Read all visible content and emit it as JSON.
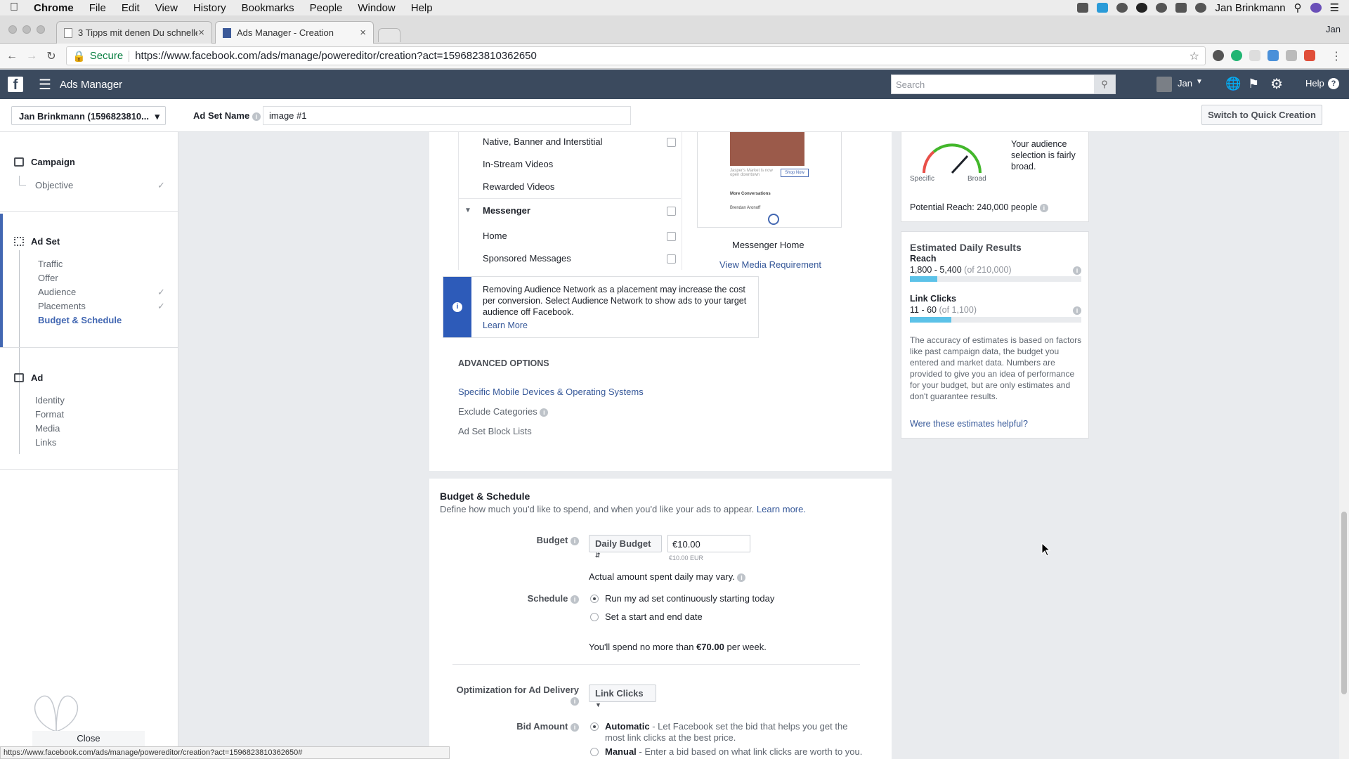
{
  "menubar": {
    "app": "Chrome",
    "items": [
      "File",
      "Edit",
      "View",
      "History",
      "Bookmarks",
      "People",
      "Window",
      "Help"
    ],
    "user": "Jan Brinkmann"
  },
  "browser": {
    "tabs": [
      {
        "title": "3 Tipps mit denen Du schnelle"
      },
      {
        "title": "Ads Manager - Creation"
      }
    ],
    "profile": "Jan",
    "secure_label": "Secure",
    "url": "https://www.facebook.com/ads/manage/powereditor/creation?act=1596823810362650",
    "status_url": "https://www.facebook.com/ads/manage/powereditor/creation?act=1596823810362650#"
  },
  "fb_header": {
    "title": "Ads Manager",
    "search_placeholder": "Search",
    "user": "Jan",
    "help": "Help"
  },
  "name_bar": {
    "account": "Jan Brinkmann (1596823810...",
    "label": "Ad Set Name",
    "value": "image #1",
    "quick_button": "Switch to Quick Creation"
  },
  "sidebar": {
    "campaign": {
      "label": "Campaign",
      "items": [
        "Objective"
      ]
    },
    "adset": {
      "label": "Ad Set",
      "items": [
        "Traffic",
        "Offer",
        "Audience",
        "Placements",
        "Budget & Schedule"
      ]
    },
    "ad": {
      "label": "Ad",
      "items": [
        "Identity",
        "Format",
        "Media",
        "Links"
      ]
    },
    "close": "Close"
  },
  "placements": {
    "rows": [
      "Native, Banner and Interstitial",
      "In-Stream Videos",
      "Rewarded Videos"
    ],
    "messenger": "Messenger",
    "messenger_rows": [
      "Home",
      "Sponsored Messages"
    ],
    "preview_caption": "Messenger Home",
    "preview_link": "View Media Requirement",
    "preview_small_text": "Jasper's Market is now open downtown",
    "preview_shop": "Shop Now",
    "preview_more": "More Conversations",
    "preview_name": "Brendan Aronoff"
  },
  "notice": {
    "text": "Removing Audience Network as a placement may increase the cost per conversion. Select Audience Network to show ads to your target audience off Facebook.",
    "link": "Learn More"
  },
  "advanced": {
    "title": "ADVANCED OPTIONS",
    "devices": "Specific Mobile Devices & Operating Systems",
    "exclude": "Exclude Categories",
    "block": "Ad Set Block Lists"
  },
  "budget": {
    "title": "Budget & Schedule",
    "desc": "Define how much you'd like to spend, and when you'd like your ads to appear.",
    "learn": "Learn more.",
    "budget_label": "Budget",
    "budget_type": "Daily Budget",
    "amount": "€10.00",
    "amount_sub": "€10.00 EUR",
    "vary_note": "Actual amount spent daily may vary.",
    "schedule_label": "Schedule",
    "opt_continuous": "Run my ad set continuously starting today",
    "opt_dates": "Set a start and end date",
    "spend_prefix": "You'll spend no more than",
    "spend_amount": "€70.00",
    "spend_suffix": "per week.",
    "optimization_label": "Optimization for Ad Delivery",
    "optimization_value": "Link Clicks",
    "bid_label": "Bid Amount",
    "bid_auto": "Automatic",
    "bid_auto_desc": "- Let Facebook set the bid that helps you get the most link clicks at the best price.",
    "bid_manual": "Manual",
    "bid_manual_desc": "- Enter a bid based on what link clicks are worth to you."
  },
  "audience_meter": {
    "specific": "Specific",
    "broad": "Broad",
    "summary": "Your audience selection is fairly broad.",
    "potential": "Potential Reach: 240,000 people"
  },
  "estimates": {
    "title": "Estimated Daily Results",
    "reach_label": "Reach",
    "reach_value": "1,800 - 5,400",
    "reach_of": "(of 210,000)",
    "reach_fill": 0.16,
    "clicks_label": "Link Clicks",
    "clicks_value": "11 - 60",
    "clicks_of": "(of 1,100)",
    "clicks_fill": 0.24,
    "accuracy": "The accuracy of estimates is based on factors like past campaign data, the budget you entered and market data. Numbers are provided to give you an idea of performance for your budget, but are only estimates and don't guarantee results.",
    "helpful": "Were these estimates helpful?"
  }
}
